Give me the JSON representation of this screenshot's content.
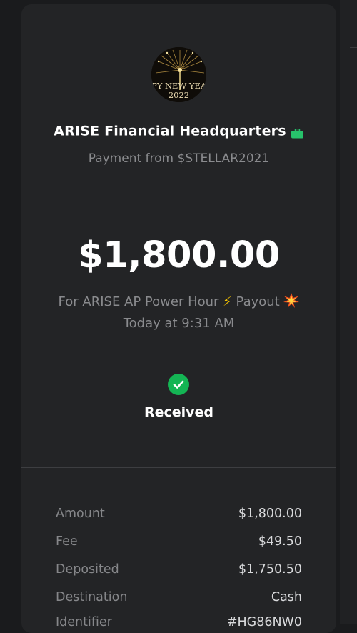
{
  "avatar": {
    "line1": "PY NEW YEAR",
    "line2": "2022"
  },
  "merchant": {
    "name": "ARISE Financial Headquarters",
    "badge_icon": "briefcase-icon",
    "badge_color": "#27c26b"
  },
  "payment_from": "Payment from $STELLAR2021",
  "amount": "$1,800.00",
  "note": {
    "before": "For ARISE AP Power Hour ",
    "icon1": "⚡",
    "middle": " Payout ",
    "icon2": "collision-icon"
  },
  "time": "Today at 9:31 AM",
  "status": {
    "label": "Received",
    "icon": "check-circle-icon",
    "color": "#14b554"
  },
  "details": [
    {
      "label": "Amount",
      "value": "$1,800.00"
    },
    {
      "label": "Fee",
      "value": "$49.50"
    },
    {
      "label": "Deposited",
      "value": "$1,750.50"
    },
    {
      "label": "Destination",
      "value": "Cash"
    },
    {
      "label": "Identifier",
      "value": "#HG86NW0"
    }
  ]
}
